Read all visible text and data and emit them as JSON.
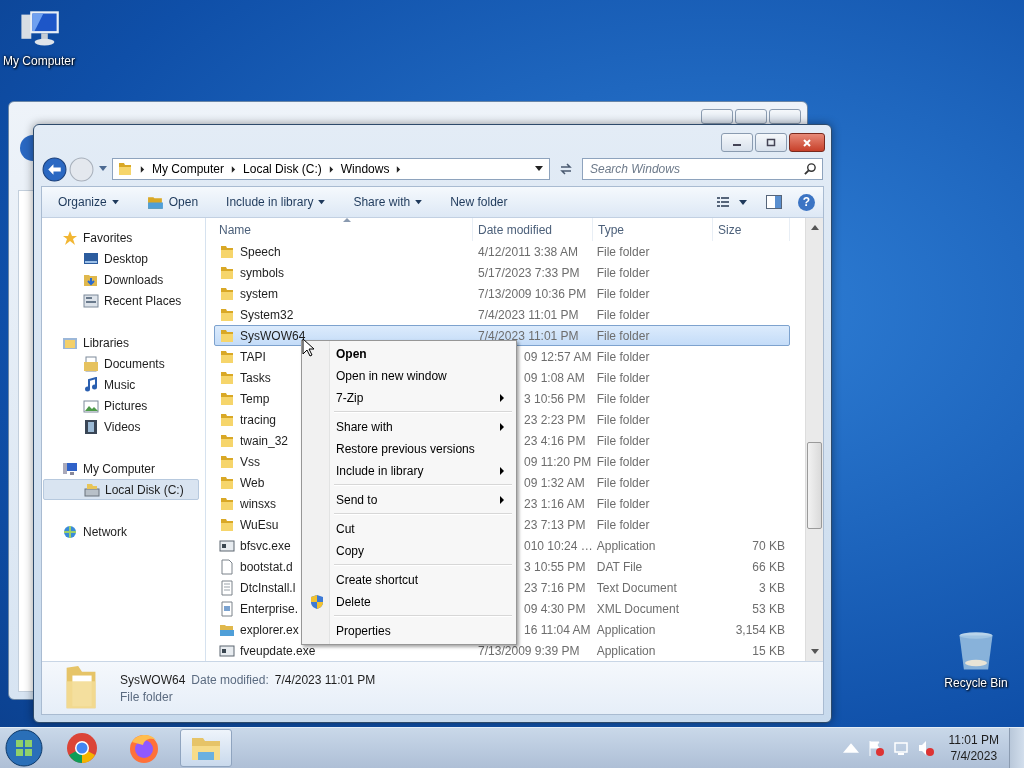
{
  "desktop_icons": [
    {
      "label": "My Computer",
      "kind": "computer"
    },
    {
      "label": "Recycle Bin",
      "kind": "recycle"
    }
  ],
  "window": {
    "address": {
      "crumbs": [
        "My Computer",
        "Local Disk (C:)",
        "Windows"
      ]
    },
    "search": {
      "placeholder": "Search Windows"
    },
    "toolbar": {
      "buttons": [
        {
          "label": "Organize",
          "dropdown": true,
          "icon": false
        },
        {
          "label": "Open",
          "dropdown": false,
          "icon": true
        },
        {
          "label": "Include in library",
          "dropdown": true,
          "icon": false
        },
        {
          "label": "Share with",
          "dropdown": true,
          "icon": false
        },
        {
          "label": "New folder",
          "dropdown": false,
          "icon": false
        }
      ],
      "help": "?"
    },
    "nav": [
      {
        "label": "Favorites",
        "kind": "star",
        "selected": false,
        "items": [
          {
            "label": "Desktop",
            "kind": "desktop",
            "selected": false
          },
          {
            "label": "Downloads",
            "kind": "downloads",
            "selected": false
          },
          {
            "label": "Recent Places",
            "kind": "recent",
            "selected": false
          }
        ]
      },
      {
        "label": "Libraries",
        "kind": "library",
        "selected": false,
        "items": [
          {
            "label": "Documents",
            "kind": "documents",
            "selected": false
          },
          {
            "label": "Music",
            "kind": "music",
            "selected": false
          },
          {
            "label": "Pictures",
            "kind": "pictures",
            "selected": false
          },
          {
            "label": "Videos",
            "kind": "videos",
            "selected": false
          }
        ]
      },
      {
        "label": "My Computer",
        "kind": "computer",
        "selected": false,
        "items": [
          {
            "label": "Local Disk (C:)",
            "kind": "drive",
            "selected": true
          }
        ]
      },
      {
        "label": "Network",
        "kind": "network",
        "selected": false
      }
    ],
    "columns": [
      {
        "label": "Name",
        "sorted": true
      },
      {
        "label": "Date modified",
        "sorted": false
      },
      {
        "label": "Type",
        "sorted": false
      },
      {
        "label": "Size",
        "sorted": false
      }
    ],
    "rows": [
      {
        "name": "Speech",
        "date": "4/12/2011 3:38 AM",
        "type": "File folder",
        "size": "",
        "kind": "folder",
        "selected": false,
        "under_menu": false
      },
      {
        "name": "symbols",
        "date": "5/17/2023 7:33 PM",
        "type": "File folder",
        "size": "",
        "kind": "folder",
        "selected": false,
        "under_menu": false
      },
      {
        "name": "system",
        "date": "7/13/2009 10:36 PM",
        "type": "File folder",
        "size": "",
        "kind": "folder",
        "selected": false,
        "under_menu": false
      },
      {
        "name": "System32",
        "date": "7/4/2023 11:01 PM",
        "type": "File folder",
        "size": "",
        "kind": "folder",
        "selected": false,
        "under_menu": false
      },
      {
        "name": "SysWOW64",
        "date": "7/4/2023 11:01 PM",
        "type": "File folder",
        "size": "",
        "kind": "folder",
        "selected": true,
        "under_menu": false
      },
      {
        "name": "TAPI",
        "date": "09 12:57 AM",
        "type": "File folder",
        "size": "",
        "kind": "folder",
        "selected": false,
        "under_menu": true
      },
      {
        "name": "Tasks",
        "date": "09 1:08 AM",
        "type": "File folder",
        "size": "",
        "kind": "folder",
        "selected": false,
        "under_menu": true
      },
      {
        "name": "Temp",
        "date": "3 10:56 PM",
        "type": "File folder",
        "size": "",
        "kind": "folder",
        "selected": false,
        "under_menu": true
      },
      {
        "name": "tracing",
        "date": "23 2:23 PM",
        "type": "File folder",
        "size": "",
        "kind": "folder",
        "selected": false,
        "under_menu": true
      },
      {
        "name": "twain_32",
        "date": "23 4:16 PM",
        "type": "File folder",
        "size": "",
        "kind": "folder",
        "selected": false,
        "under_menu": true
      },
      {
        "name": "Vss",
        "date": "09 11:20 PM",
        "type": "File folder",
        "size": "",
        "kind": "folder",
        "selected": false,
        "under_menu": true
      },
      {
        "name": "Web",
        "date": "09 1:32 AM",
        "type": "File folder",
        "size": "",
        "kind": "folder",
        "selected": false,
        "under_menu": true
      },
      {
        "name": "winsxs",
        "date": "23 1:16 AM",
        "type": "File folder",
        "size": "",
        "kind": "folder",
        "selected": false,
        "under_menu": true
      },
      {
        "name": "WuEsu",
        "date": "23 7:13 PM",
        "type": "File folder",
        "size": "",
        "kind": "folder",
        "selected": false,
        "under_menu": true
      },
      {
        "name": "bfsvc.exe",
        "date": "010 10:24 …",
        "type": "Application",
        "size": "70 KB",
        "kind": "app",
        "selected": false,
        "under_menu": true
      },
      {
        "name": "bootstat.d",
        "date": "3 10:55 PM",
        "type": "DAT File",
        "size": "66 KB",
        "kind": "file",
        "selected": false,
        "under_menu": true
      },
      {
        "name": "DtcInstall.l",
        "date": "23 7:16 PM",
        "type": "Text Document",
        "size": "3 KB",
        "kind": "text",
        "selected": false,
        "under_menu": true
      },
      {
        "name": "Enterprise.",
        "date": "09 4:30 PM",
        "type": "XML Document",
        "size": "53 KB",
        "kind": "xml",
        "selected": false,
        "under_menu": true
      },
      {
        "name": "explorer.ex",
        "date": "16 11:04 AM",
        "type": "Application",
        "size": "3,154 KB",
        "kind": "explorer",
        "selected": false,
        "under_menu": true
      },
      {
        "name": "fveupdate.exe",
        "date": "7/13/2009 9:39 PM",
        "type": "Application",
        "size": "15 KB",
        "kind": "app",
        "selected": false,
        "under_menu": false
      }
    ],
    "context_menu": {
      "groups": [
        [
          {
            "label": "Open",
            "default": true,
            "submenu": false,
            "shielded": false
          },
          {
            "label": "Open in new window",
            "default": false,
            "submenu": false,
            "shielded": false
          },
          {
            "label": "7-Zip",
            "default": false,
            "submenu": true,
            "shielded": false
          }
        ],
        [
          {
            "label": "Share with",
            "default": false,
            "submenu": true,
            "shielded": false
          },
          {
            "label": "Restore previous versions",
            "default": false,
            "submenu": false,
            "shielded": false
          },
          {
            "label": "Include in library",
            "default": false,
            "submenu": true,
            "shielded": false
          }
        ],
        [
          {
            "label": "Send to",
            "default": false,
            "submenu": true,
            "shielded": false
          }
        ],
        [
          {
            "label": "Cut",
            "default": false,
            "submenu": false,
            "shielded": false
          },
          {
            "label": "Copy",
            "default": false,
            "submenu": false,
            "shielded": false
          }
        ],
        [
          {
            "label": "Create shortcut",
            "default": false,
            "submenu": false,
            "shielded": false
          },
          {
            "label": "Delete",
            "default": false,
            "submenu": false,
            "shielded": true
          }
        ],
        [
          {
            "label": "Properties",
            "default": false,
            "submenu": false,
            "shielded": false
          }
        ]
      ]
    },
    "details": {
      "name": "SysWOW64",
      "date_label": "Date modified:",
      "date": "7/4/2023 11:01 PM",
      "type": "File folder"
    }
  },
  "taskbar": {
    "apps": [
      {
        "kind": "chrome",
        "active": false
      },
      {
        "kind": "firefox",
        "active": false
      },
      {
        "kind": "explorer",
        "active": true
      }
    ],
    "clock": {
      "time": "11:01 PM",
      "date": "7/4/2023"
    }
  }
}
